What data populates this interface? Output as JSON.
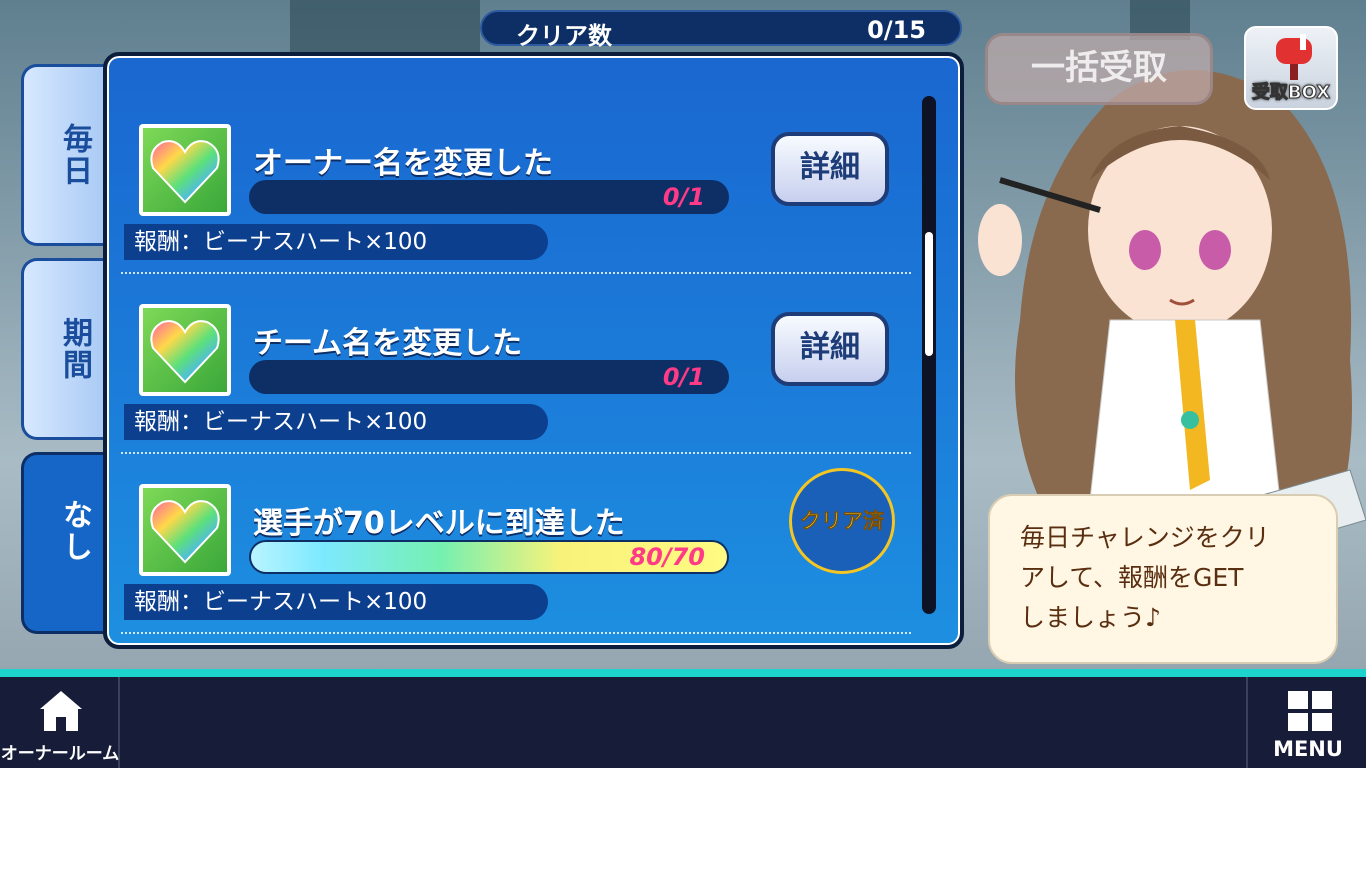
{
  "header": {
    "clear_label": "クリア数",
    "clear_count": "0/15"
  },
  "top_buttons": {
    "receive_all": "一括受取",
    "receive_box": "受取BOX"
  },
  "tabs": [
    {
      "label": "毎日",
      "selected": false
    },
    {
      "label": "期間",
      "selected": false
    },
    {
      "label": "期限なし",
      "selected": true
    }
  ],
  "missions": [
    {
      "title": "オーナー名を変更した",
      "progress_text": "0/1",
      "progress": 0,
      "reward": "報酬：ビーナスハート×100",
      "action": "詳細",
      "cleared": false
    },
    {
      "title": "チーム名を変更した",
      "progress_text": "0/1",
      "progress": 0,
      "reward": "報酬：ビーナスハート×100",
      "action": "詳細",
      "cleared": false
    },
    {
      "title": "選手が70レベルに到達した",
      "progress_text": "80/70",
      "progress": 1,
      "reward": "報酬：ビーナスハート×100",
      "action": "クリア済",
      "cleared": true
    }
  ],
  "speech": {
    "line1": "毎日チャレンジをクリ",
    "line2": "アして、報酬をGET",
    "line3": "しましょう♪"
  },
  "bottom_nav": {
    "owner_room": "オーナールーム",
    "menu": "MENU"
  },
  "colors": {
    "accent": "#1dd4cc",
    "panel": "#1b7ad8",
    "nav_bg": "#171d38",
    "progress_text": "#ff3a86"
  }
}
